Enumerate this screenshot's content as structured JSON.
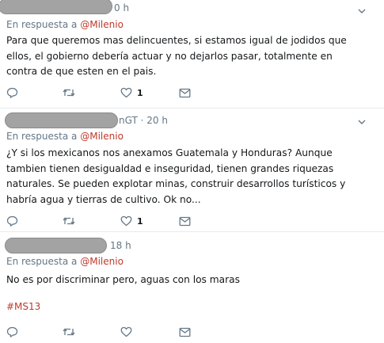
{
  "tweets": [
    {
      "time": "0 h",
      "reply_label": "En respuesta a ",
      "mention": "@Milenio",
      "text": "Para que queremos mas delincuentes, si estamos igual de jodidos que ellos, el gobierno debería actuar y no dejarlos pasar, totalmente en contra de que esten en el pais.",
      "like_count": "1",
      "hashtag": ""
    },
    {
      "time": "nGT · 20 h",
      "reply_label": "En respuesta a ",
      "mention": "@Milenio",
      "text": "¿Y si los mexicanos nos anexamos Guatemala y Honduras? Aunque tambien tienen desigualdad e inseguridad, tienen grandes riquezas naturales. Se pueden explotar minas, construir desarrollos turísticos y habría agua y tierras de cultivo. Ok no...",
      "like_count": "1",
      "hashtag": ""
    },
    {
      "time": "18 h",
      "reply_label": "En respuesta a ",
      "mention": "@Milenio",
      "text": "No es por discriminar pero, aguas con los maras",
      "like_count": "",
      "hashtag": "#MS13"
    }
  ],
  "icons": {
    "reply": "reply-icon",
    "retweet": "retweet-icon",
    "like": "heart-icon",
    "dm": "envelope-icon",
    "caret": "chevron-down-icon"
  },
  "colors": {
    "mention": "#c0392b",
    "meta": "#657786",
    "divider": "#e6ecf0"
  }
}
